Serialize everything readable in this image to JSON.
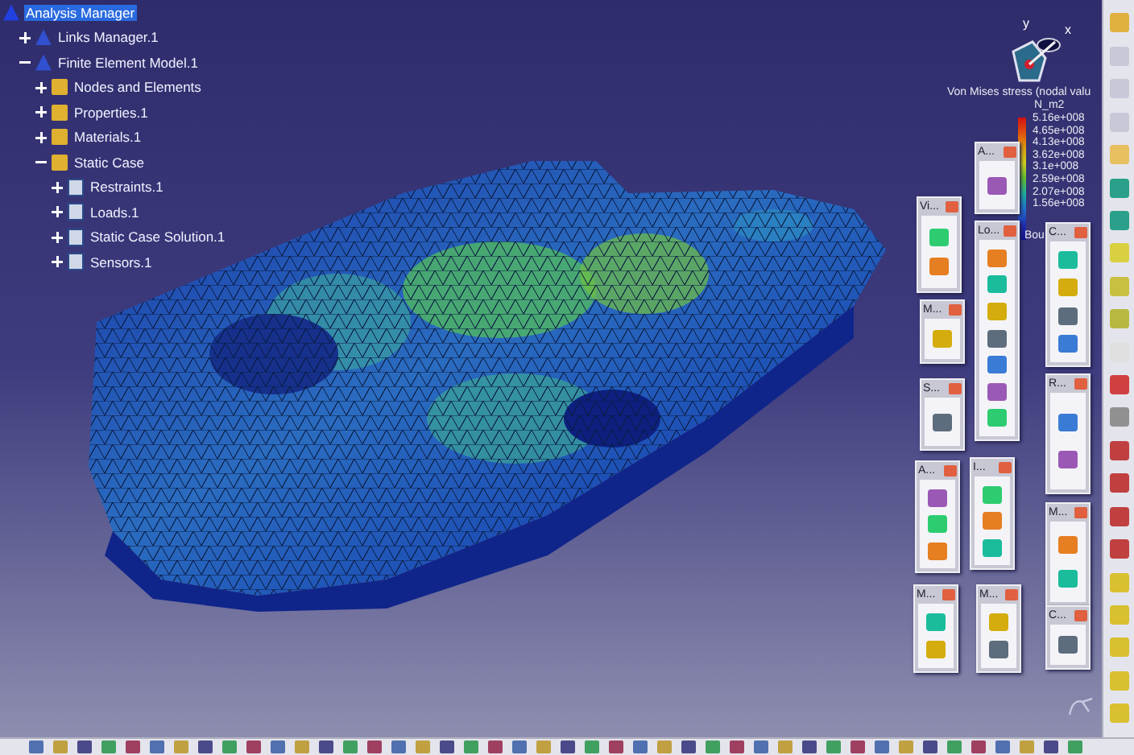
{
  "tree": {
    "label": "Analysis Manager",
    "selected": true,
    "children": [
      {
        "label": "Links Manager.1",
        "expanded": false
      },
      {
        "label": "Finite Element Model.1",
        "expanded": true,
        "children": [
          {
            "label": "Nodes and Elements",
            "expanded": false
          },
          {
            "label": "Properties.1",
            "expanded": false
          },
          {
            "label": "Materials.1",
            "expanded": false
          },
          {
            "label": "Static Case",
            "expanded": true,
            "children": [
              {
                "label": "Restraints.1",
                "expanded": false
              },
              {
                "label": "Loads.1",
                "expanded": false
              },
              {
                "label": "Static Case Solution.1",
                "expanded": false
              },
              {
                "label": "Sensors.1",
                "expanded": false
              }
            ]
          }
        ]
      }
    ]
  },
  "compass": {
    "y_label": "y",
    "x_label": "x"
  },
  "legend": {
    "title": "Von Mises stress (nodal valu",
    "unit": "N_m2",
    "values": [
      "5.16e+008",
      "4.65e+008",
      "4.13e+008",
      "3.62e+008",
      "3.1e+008",
      "2.59e+008",
      "2.07e+008",
      "1.56e+008"
    ],
    "footer": "Bou"
  },
  "toolbars": [
    {
      "title": "A..."
    },
    {
      "title": "Vi..."
    },
    {
      "title": "Lo..."
    },
    {
      "title": "C..."
    },
    {
      "title": "M..."
    },
    {
      "title": "S..."
    },
    {
      "title": "R..."
    },
    {
      "title": "A..."
    },
    {
      "title": "I..."
    },
    {
      "title": "M..."
    },
    {
      "title": "M..."
    },
    {
      "title": "M..."
    },
    {
      "title": "C..."
    }
  ]
}
